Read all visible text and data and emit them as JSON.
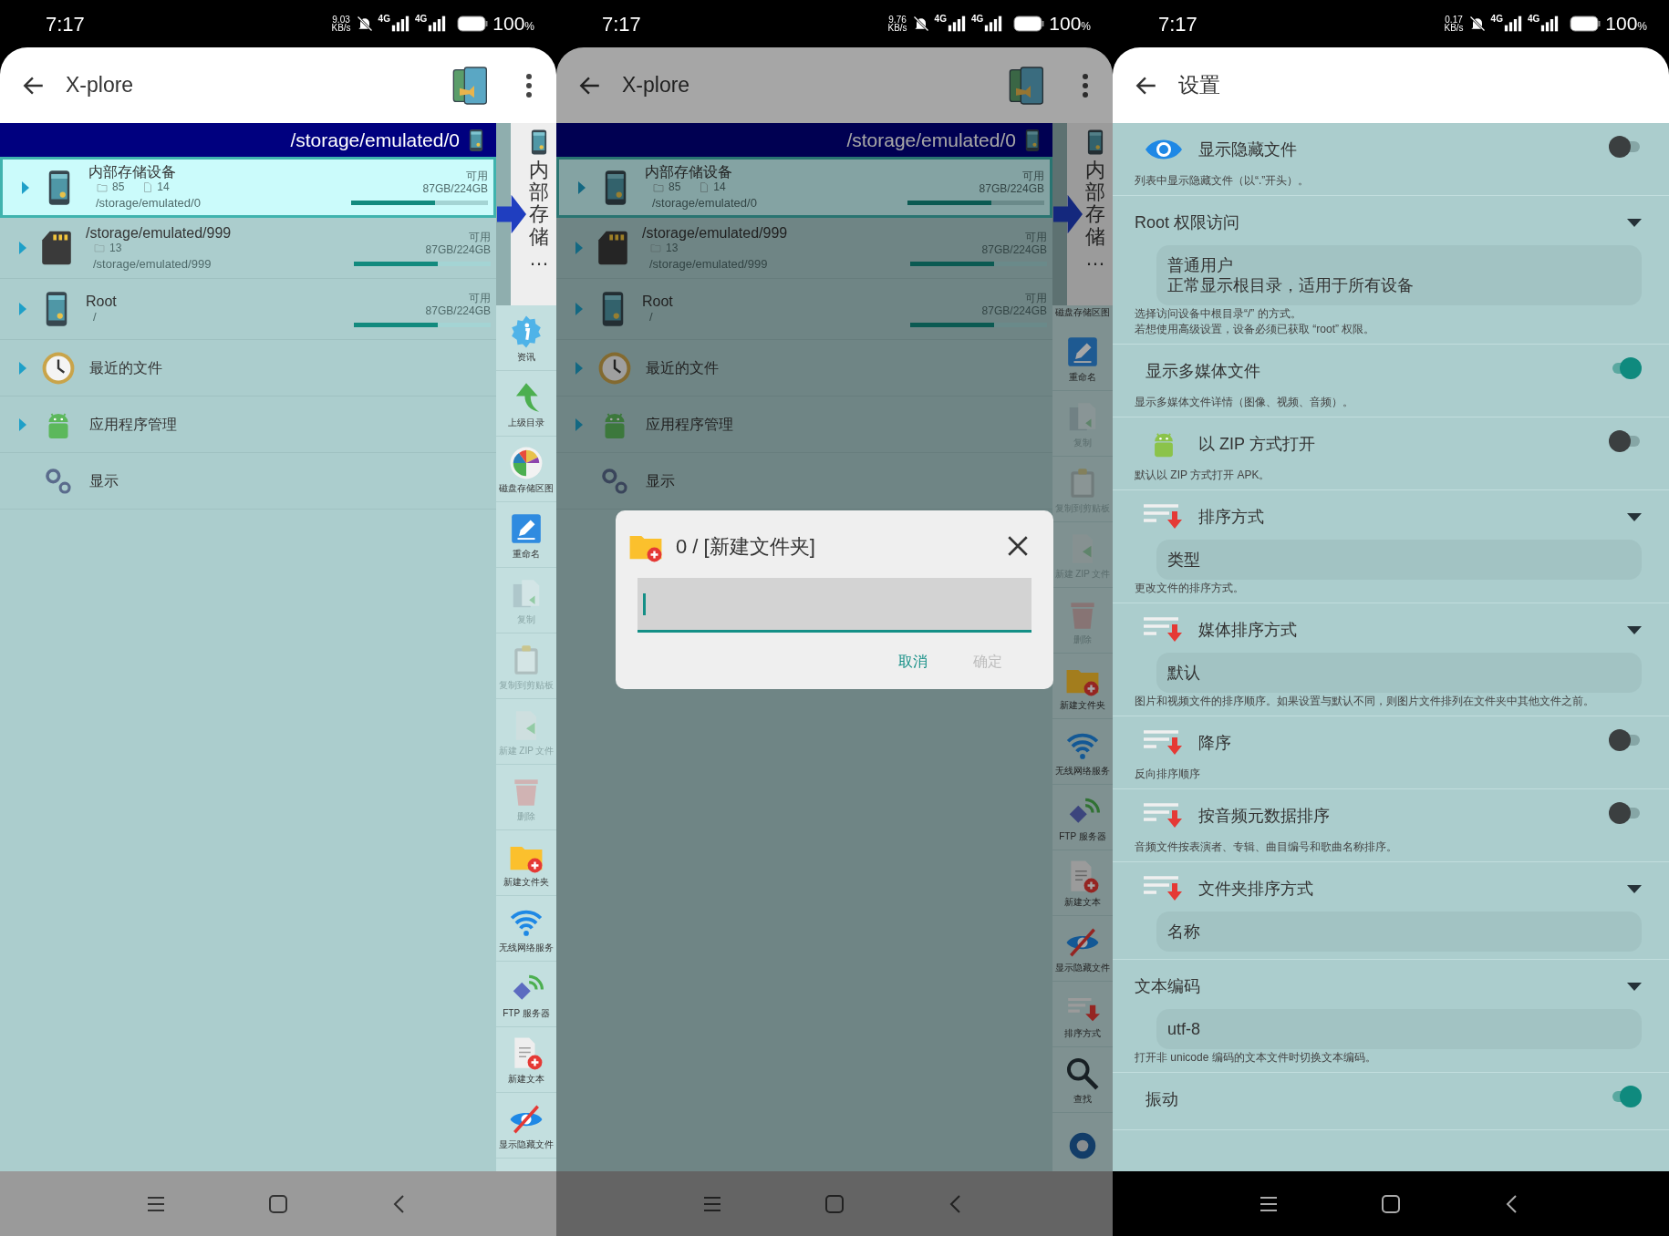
{
  "screens": [
    {
      "kind": "browser",
      "dimmed": false,
      "status_bar": {
        "time": "7:17",
        "speed": "9.03",
        "speed_unit": "KB/s",
        "sim1": "4G",
        "sim2": "4G",
        "battery": "100",
        "battery_unit": "%"
      },
      "app_bar": {
        "title": "X-plore"
      },
      "path": "/storage/emulated/0",
      "rows": [
        {
          "kind": "storage",
          "name": "内部存储设备",
          "folders": "85",
          "files": "14",
          "path": "/storage/emulated/0",
          "free_label": "可用",
          "size": "87GB/224GB",
          "level": 0.61,
          "selected": true
        },
        {
          "kind": "storage",
          "name": "/storage/emulated/999",
          "folders": "13",
          "path": "/storage/emulated/999",
          "free_label": "可用",
          "size": "87GB/224GB",
          "level": 0.61,
          "selected": false
        },
        {
          "kind": "storage",
          "name": "Root",
          "path": "/",
          "free_label": "可用",
          "size": "87GB/224GB",
          "level": 0.61,
          "selected": false
        },
        {
          "kind": "entry",
          "name": "最近的文件",
          "expandable": true,
          "selected": false
        },
        {
          "kind": "entry",
          "name": "应用程序管理",
          "expandable": true,
          "selected": false
        },
        {
          "kind": "entry",
          "name": "显示",
          "expandable": false,
          "selected": false
        }
      ],
      "side_tab": "内部存储…",
      "side_items": [
        {
          "kind": "info",
          "label": "资讯",
          "disabled": false
        },
        {
          "kind": "up",
          "label": "上级目录",
          "disabled": false
        },
        {
          "kind": "chart",
          "label": "磁盘存储区图",
          "disabled": false
        },
        {
          "kind": "rename",
          "label": "重命名",
          "disabled": false
        },
        {
          "kind": "copy",
          "label": "复制",
          "disabled": true
        },
        {
          "kind": "clipboard",
          "label": "复制到剪贴板",
          "disabled": true
        },
        {
          "kind": "zip",
          "label": "新建 ZIP 文件",
          "disabled": true
        },
        {
          "kind": "delete",
          "label": "删除",
          "disabled": true
        },
        {
          "kind": "newfolder",
          "label": "新建文件夹",
          "disabled": false
        },
        {
          "kind": "wifi",
          "label": "无线网络服务",
          "disabled": false
        },
        {
          "kind": "ftp",
          "label": "FTP 服务器",
          "disabled": false
        },
        {
          "kind": "newtext",
          "label": "新建文本",
          "disabled": false
        },
        {
          "kind": "hidden",
          "label": "显示隐藏文件",
          "disabled": false
        }
      ]
    },
    {
      "kind": "browser",
      "dimmed": true,
      "status_bar": {
        "time": "7:17",
        "speed": "9.76",
        "speed_unit": "KB/s",
        "sim1": "4G",
        "sim2": "4G",
        "battery": "100",
        "battery_unit": "%"
      },
      "app_bar": {
        "title": "X-plore"
      },
      "path": "/storage/emulated/0",
      "rows": [
        {
          "kind": "storage",
          "name": "内部存储设备",
          "folders": "85",
          "files": "14",
          "path": "/storage/emulated/0",
          "free_label": "可用",
          "size": "87GB/224GB",
          "level": 0.61,
          "selected": true
        },
        {
          "kind": "storage",
          "name": "/storage/emulated/999",
          "folders": "13",
          "path": "/storage/emulated/999",
          "free_label": "可用",
          "size": "87GB/224GB",
          "level": 0.61,
          "selected": false
        },
        {
          "kind": "storage",
          "name": "Root",
          "path": "/",
          "free_label": "可用",
          "size": "87GB/224GB",
          "level": 0.61,
          "selected": false
        },
        {
          "kind": "entry",
          "name": "最近的文件",
          "expandable": true,
          "selected": false
        },
        {
          "kind": "entry",
          "name": "应用程序管理",
          "expandable": true,
          "selected": false
        },
        {
          "kind": "entry",
          "name": "显示",
          "expandable": false,
          "selected": false
        }
      ],
      "side_tab": "内部存储…",
      "side_items": [
        {
          "kind": "label",
          "label": "磁盘存储区图",
          "disabled": false
        },
        {
          "kind": "rename",
          "label": "重命名",
          "disabled": false
        },
        {
          "kind": "copy",
          "label": "复制",
          "disabled": true
        },
        {
          "kind": "clipboard",
          "label": "复制到剪贴板",
          "disabled": true
        },
        {
          "kind": "zip",
          "label": "新建 ZIP 文件",
          "disabled": true
        },
        {
          "kind": "delete",
          "label": "删除",
          "disabled": true
        },
        {
          "kind": "newfolder",
          "label": "新建文件夹",
          "disabled": false
        },
        {
          "kind": "wifi",
          "label": "无线网络服务",
          "disabled": false
        },
        {
          "kind": "ftp",
          "label": "FTP 服务器",
          "disabled": false
        },
        {
          "kind": "newtext",
          "label": "新建文本",
          "disabled": false
        },
        {
          "kind": "hidden",
          "label": "显示隐藏文件",
          "disabled": false
        },
        {
          "kind": "sort",
          "label": "排序方式",
          "disabled": false
        },
        {
          "kind": "search",
          "label": "查找",
          "disabled": false
        },
        {
          "kind": "gear",
          "disabled": false
        }
      ],
      "dialog": {
        "title": "0 / [新建文件夹]",
        "buttons": [
          {
            "label": "取消",
            "disabled": false
          },
          {
            "label": "确定",
            "disabled": true
          }
        ]
      }
    },
    {
      "kind": "settings",
      "status_bar": {
        "time": "7:17",
        "speed": "0.17",
        "speed_unit": "KB/s",
        "sim1": "4G",
        "sim2": "4G",
        "battery": "100",
        "battery_unit": "%"
      },
      "app_bar": {
        "title": "设置"
      },
      "items": [
        {
          "kind": "toggle",
          "title": "显示隐藏文件",
          "on": false,
          "description": "列表中显示隐藏文件（以“.”开头）。"
        },
        {
          "kind": "dropdown",
          "title": "Root 权限访问",
          "value": [
            "普通用户",
            "正常显示根目录，适用于所有设备"
          ],
          "description": [
            "选择访问设备中根目录“/” 的方式。",
            "若想使用高级设置，设备必须已获取 “root” 权限。"
          ]
        },
        {
          "kind": "toggle",
          "title": "显示多媒体文件",
          "on": true,
          "description": "显示多媒体文件详情（图像、视频、音频）。"
        },
        {
          "kind": "toggle",
          "title": "以 ZIP 方式打开",
          "on": false,
          "description": "默认以 ZIP 方式打开 APK。"
        },
        {
          "kind": "dropdown",
          "title": "排序方式",
          "value": "类型",
          "description": "更改文件的排序方式。"
        },
        {
          "kind": "dropdown",
          "title": "媒体排序方式",
          "value": "默认",
          "description": "图片和视频文件的排序顺序。如果设置与默认不同，则图片文件排列在文件夹中其他文件之前。"
        },
        {
          "kind": "toggle",
          "title": "降序",
          "on": false,
          "description": "反向排序顺序"
        },
        {
          "kind": "toggle",
          "title": "按音频元数据排序",
          "on": false,
          "description": "音频文件按表演者、专辑、曲目编号和歌曲名称排序。"
        },
        {
          "kind": "dropdown",
          "title": "文件夹排序方式",
          "value": "名称"
        },
        {
          "kind": "dropdown",
          "title": "文本编码",
          "value": "utf-8",
          "description": "打开非 unicode 编码的文本文件时切换文本编码。"
        },
        {
          "kind": "toggle",
          "title": "振动",
          "on": true
        }
      ]
    }
  ]
}
